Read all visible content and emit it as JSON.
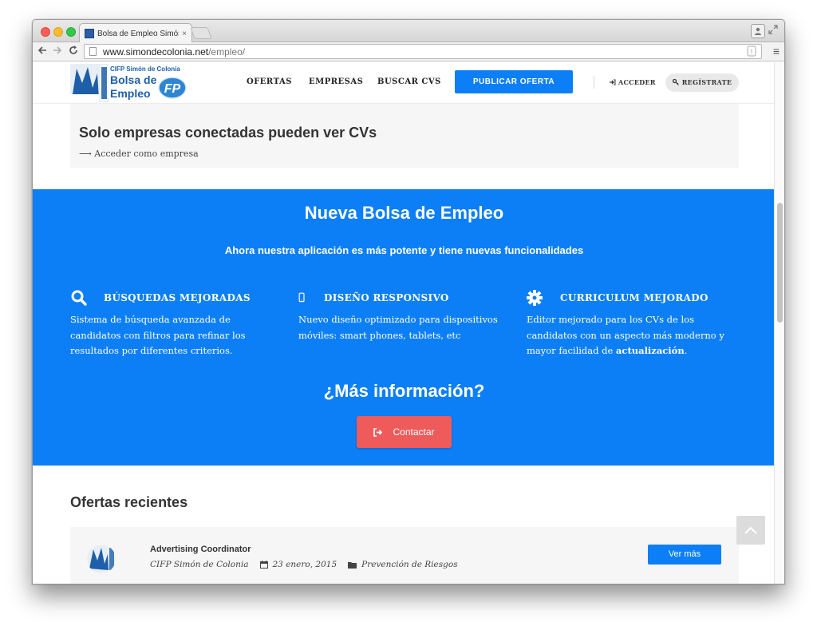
{
  "browser": {
    "tab_title": "Bolsa de Empleo Simón de",
    "tab_close": "×",
    "url_host": "www.simondecolonia.net",
    "url_path": "/empleo/",
    "menu_icon": "≡"
  },
  "header": {
    "logo_small": "CIFP Simón de Colonia",
    "logo_line1": "Bolsa de",
    "logo_line2": "Empleo",
    "nav": [
      "OFERTAS",
      "EMPRESAS",
      "BUSCAR CVS"
    ],
    "publish_button": "PUBLICAR OFERTA",
    "login": "ACCEDER",
    "register": "REGÍSTRATE"
  },
  "login_notice": {
    "title": "Solo empresas conectadas pueden ver CVs",
    "link": "Acceder como empresa",
    "link_arrow": "⟶"
  },
  "promo": {
    "title": "Nueva Bolsa de Empleo",
    "subtitle": "Ahora nuestra aplicación es más potente y tiene nuevas funcionalidades",
    "features": [
      {
        "icon": "search-icon",
        "title": "BÚSQUEDAS  MEJORADAS",
        "text": "Sistema de búsqueda avanzada de candidatos con filtros para refinar los resultados por diferentes criterios."
      },
      {
        "icon": "mobile-icon",
        "title": "DISEÑO RESPONSIVO",
        "text": "Nuevo diseño optimizado para dispositivos móviles: smart phones, tablets, etc"
      },
      {
        "icon": "gear-icon",
        "title": "CURRICULUM MEJORADO",
        "text_before": "Editor mejorado para los CVs de los candidatos con un aspecto más moderno y mayor facilidad de ",
        "text_bold": "actualización",
        "text_after": "."
      }
    ],
    "more_title": "¿Más información?",
    "contact_button": "Contactar"
  },
  "recent": {
    "title": "Ofertas recientes",
    "offers": [
      {
        "title": "Advertising Coordinator",
        "company": "CIFP Simón de Colonia",
        "date": "23 enero, 2015",
        "category": "Prevención de Riesgos",
        "button": "Ver más"
      }
    ]
  },
  "colors": {
    "accent_blue": "#0d7ff6",
    "contact_red": "#ef5b5b"
  }
}
